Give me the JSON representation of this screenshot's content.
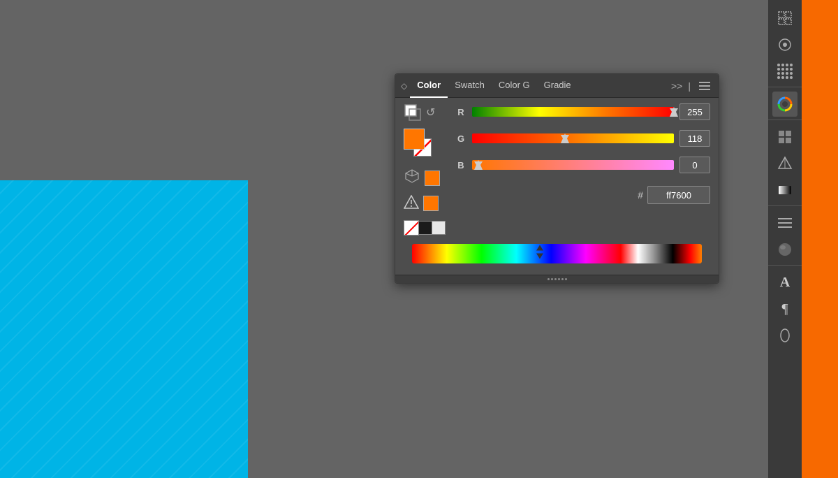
{
  "background": {
    "color": "#646464"
  },
  "canvas": {
    "blue_rect": {
      "color": "#00b4e6"
    }
  },
  "color_panel": {
    "title": "Color",
    "tabs": [
      {
        "label": "Color",
        "active": true
      },
      {
        "label": "Swatch",
        "active": false
      },
      {
        "label": "Color G",
        "active": false
      },
      {
        "label": "Gradie",
        "active": false
      }
    ],
    "more_btn": ">>",
    "menu_btn": "≡",
    "sliders": {
      "r": {
        "label": "R",
        "value": "255",
        "percent": 100
      },
      "g": {
        "label": "G",
        "value": "118",
        "percent": 46
      },
      "b": {
        "label": "B",
        "value": "0",
        "percent": 0
      }
    },
    "hex_label": "#",
    "hex_value": "ff7600",
    "current_color": "#ff7600"
  },
  "right_sidebar": {
    "color": "#f76900"
  },
  "tool_strip": {
    "tools": [
      "grid-icon",
      "circle-icon",
      "dots-icon",
      "color-wheel-icon",
      "grid-4-icon",
      "shape-icon",
      "gradient-icon",
      "menu-lines-icon",
      "sphere-icon",
      "text-A-icon",
      "paragraph-icon",
      "oval-icon"
    ]
  }
}
